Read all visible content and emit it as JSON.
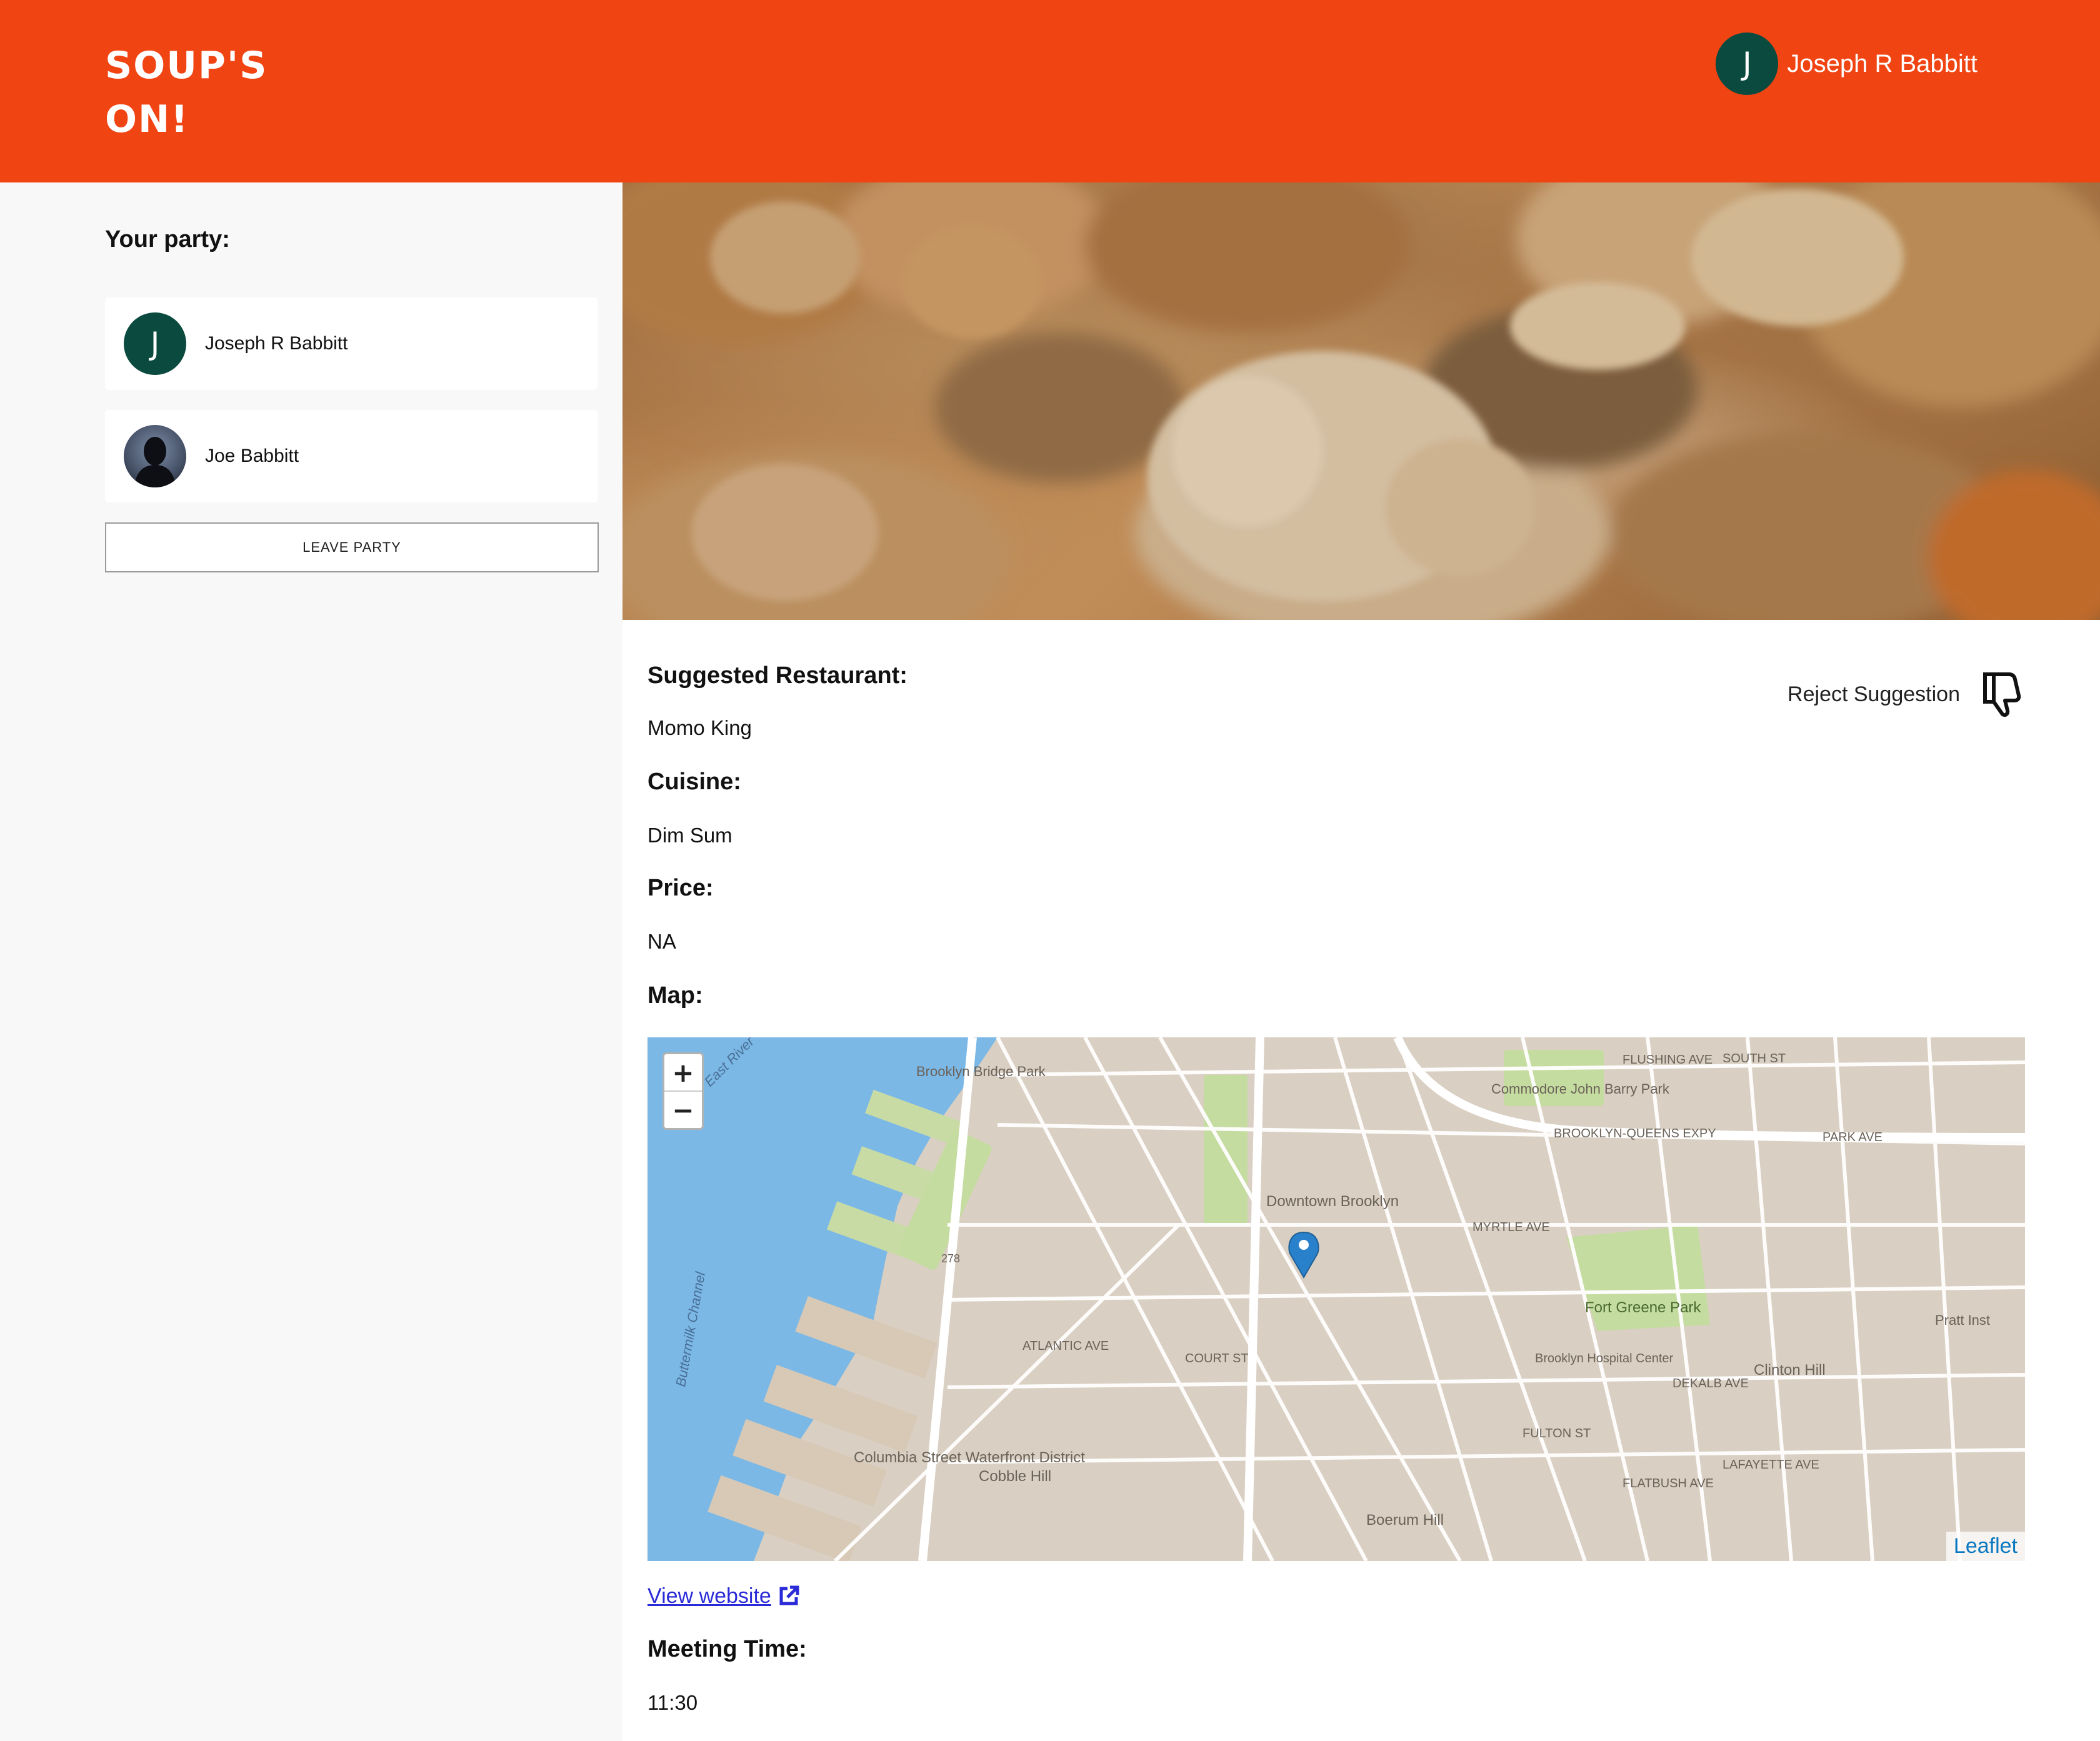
{
  "header": {
    "brand": "SOUP'S ON!",
    "user_initial": "J",
    "user_name": "Joseph R Babbitt"
  },
  "sidebar": {
    "title": "Your party:",
    "members": [
      {
        "name": "Joseph R Babbitt",
        "initial": "J",
        "avatar": "initial"
      },
      {
        "name": "Joe Babbitt",
        "initial": "",
        "avatar": "photo"
      }
    ],
    "leave_label": "LEAVE PARTY"
  },
  "suggestion": {
    "restaurant_label": "Suggested Restaurant:",
    "restaurant": "Momo King",
    "reject_label": "Reject Suggestion",
    "cuisine_label": "Cuisine:",
    "cuisine": "Dim Sum",
    "price_label": "Price:",
    "price": "NA",
    "map_label": "Map:",
    "website_label": "View website",
    "meeting_label": "Meeting Time:",
    "meeting_time": "11:30"
  },
  "map": {
    "zoom_in": "+",
    "zoom_out": "−",
    "attribution": "Leaflet",
    "labels": [
      "Brooklyn Bridge Park",
      "Commodore John Barry Park",
      "Downtown Brooklyn",
      "Fort Greene Park",
      "Brooklyn Hospital Center",
      "Columbia Street Waterfront District",
      "Cobble Hill",
      "Boerum Hill",
      "Clinton Hill",
      "Pratt Inst",
      "Buttermilk Channel",
      "East River",
      "FLUSHING AVE",
      "MYRTLE AVE",
      "ATLANTIC AVE",
      "DEKALB AVE",
      "FULTON ST",
      "LAFAYETTE AVE",
      "BROOKLYN-QUEENS EXPY",
      "COURT ST",
      "FLATBUSH AVE",
      "SOUTH ST",
      "PARK AVE",
      "278"
    ]
  },
  "colors": {
    "brand": "#f14413",
    "avatar": "#0b4a3e",
    "link": "#2a2ad8",
    "map_water": "#7bb8e6",
    "map_land": "#d9cfc2",
    "marker": "#2a81cb"
  },
  "icons": {
    "reject": "thumbs-down-icon",
    "external": "external-link-icon",
    "marker": "map-marker-icon"
  }
}
